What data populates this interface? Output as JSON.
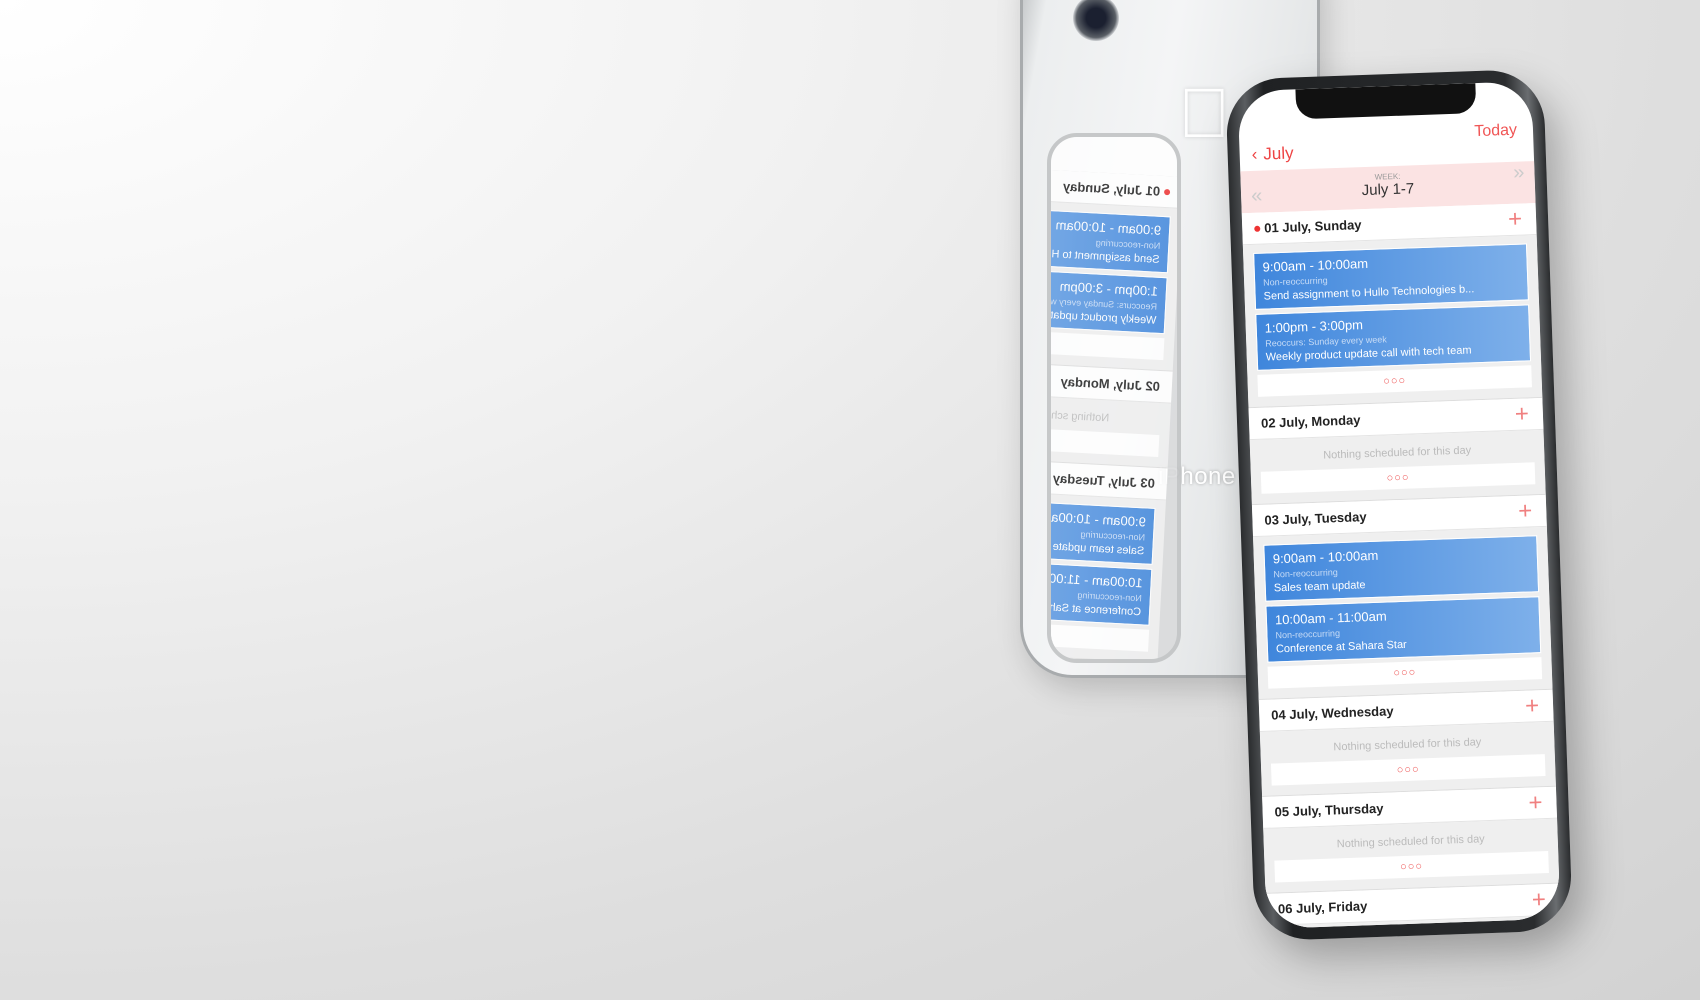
{
  "device": {
    "back_label": "iPhone",
    "apple_logo": "apple-logo"
  },
  "header": {
    "back_label": "July",
    "today_label": "Today"
  },
  "week": {
    "label": "WEEK:",
    "range": "July 1-7"
  },
  "more_label": "○○○",
  "empty_label": "Nothing scheduled for this day",
  "days": [
    {
      "title": "01 July, Sunday",
      "today": true,
      "events": [
        {
          "time": "9:00am - 10:00am",
          "recurrence": "Non-reoccurring",
          "title": "Send assignment to Hullo Technologies b..."
        },
        {
          "time": "1:00pm - 3:00pm",
          "recurrence": "Reoccurs: Sunday every week",
          "title": "Weekly product update call with tech team"
        }
      ]
    },
    {
      "title": "02 July, Monday",
      "events": []
    },
    {
      "title": "03 July, Tuesday",
      "events": [
        {
          "time": "9:00am - 10:00am",
          "recurrence": "Non-reoccurring",
          "title": "Sales team update"
        },
        {
          "time": "10:00am - 11:00am",
          "recurrence": "Non-reoccurring",
          "title": "Conference at Sahara Star"
        }
      ]
    },
    {
      "title": "04 July, Wednesday",
      "events": []
    },
    {
      "title": "05 July, Thursday",
      "events": []
    },
    {
      "title": "06 July, Friday",
      "events": []
    }
  ],
  "colors": {
    "accent": "#ee4444",
    "event": "#4a8de0",
    "week_bar": "#fbe3e3"
  }
}
